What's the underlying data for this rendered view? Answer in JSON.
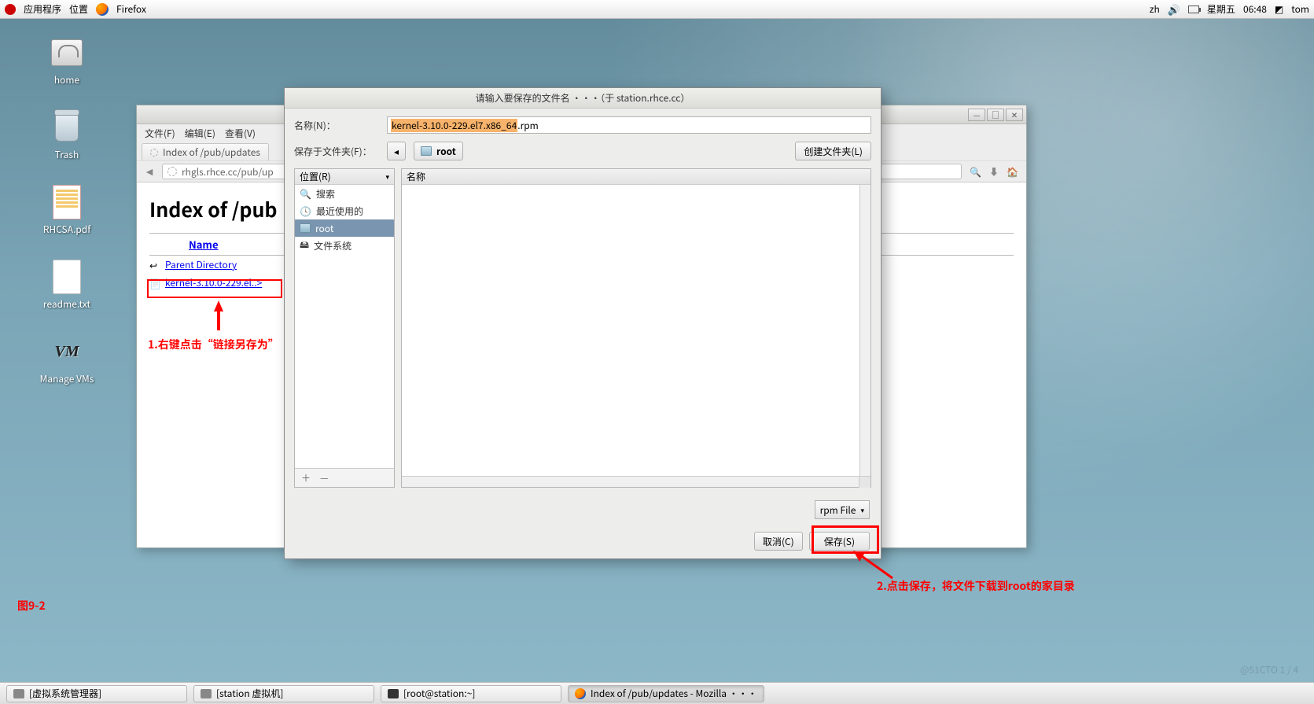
{
  "topbar": {
    "apps": "应用程序",
    "places": "位置",
    "browser": "Firefox",
    "ime": "zh",
    "day": "星期五",
    "time": "06:48",
    "user": "tom"
  },
  "desktop_icons": {
    "home": "home",
    "trash": "Trash",
    "pdf": "RHCSA.pdf",
    "txt": "readme.txt",
    "vms": "Manage VMs"
  },
  "browser": {
    "menu": {
      "file": "文件(F)",
      "edit": "编辑(E)",
      "view": "查看(V)"
    },
    "tab": "Index of /pub/updates",
    "url": "rhgls.rhce.cc/pub/up",
    "page": {
      "h1": "Index of /pub",
      "col": "Name",
      "parent": "Parent Directory",
      "file": "kernel-3.10.0-229.el..>"
    }
  },
  "annotations": {
    "a1": "1.右键点击“链接另存为”",
    "a2": "2.点击保存，将文件下载到root的家目录",
    "fig": "图9-2"
  },
  "dialog": {
    "title": "请输入要保存的文件名 ···（于  station.rhce.cc）",
    "name_lbl": "名称(N)：",
    "name_sel": "kernel-3.10.0-229.el7.x86_64",
    "name_rest": ".rpm",
    "loc_lbl": "保存于文件夹(F)：",
    "loc_val": "root",
    "mkdir": "创建文件夹(L)",
    "places_hdr": "位置(R)",
    "names_hdr": "名称",
    "places": {
      "search": "搜索",
      "recent": "最近使用的",
      "root": "root",
      "fs": "文件系统"
    },
    "filter": "rpm File",
    "cancel": "取消(C)",
    "save": "保存(S)"
  },
  "taskbar": {
    "t1": "[虚拟系统管理器]",
    "t2": "[station 虚拟机]",
    "t3": "[root@station:~]",
    "t4": "Index of /pub/updates - Mozilla ···"
  },
  "watermark": "@51CTO   1 / 4"
}
